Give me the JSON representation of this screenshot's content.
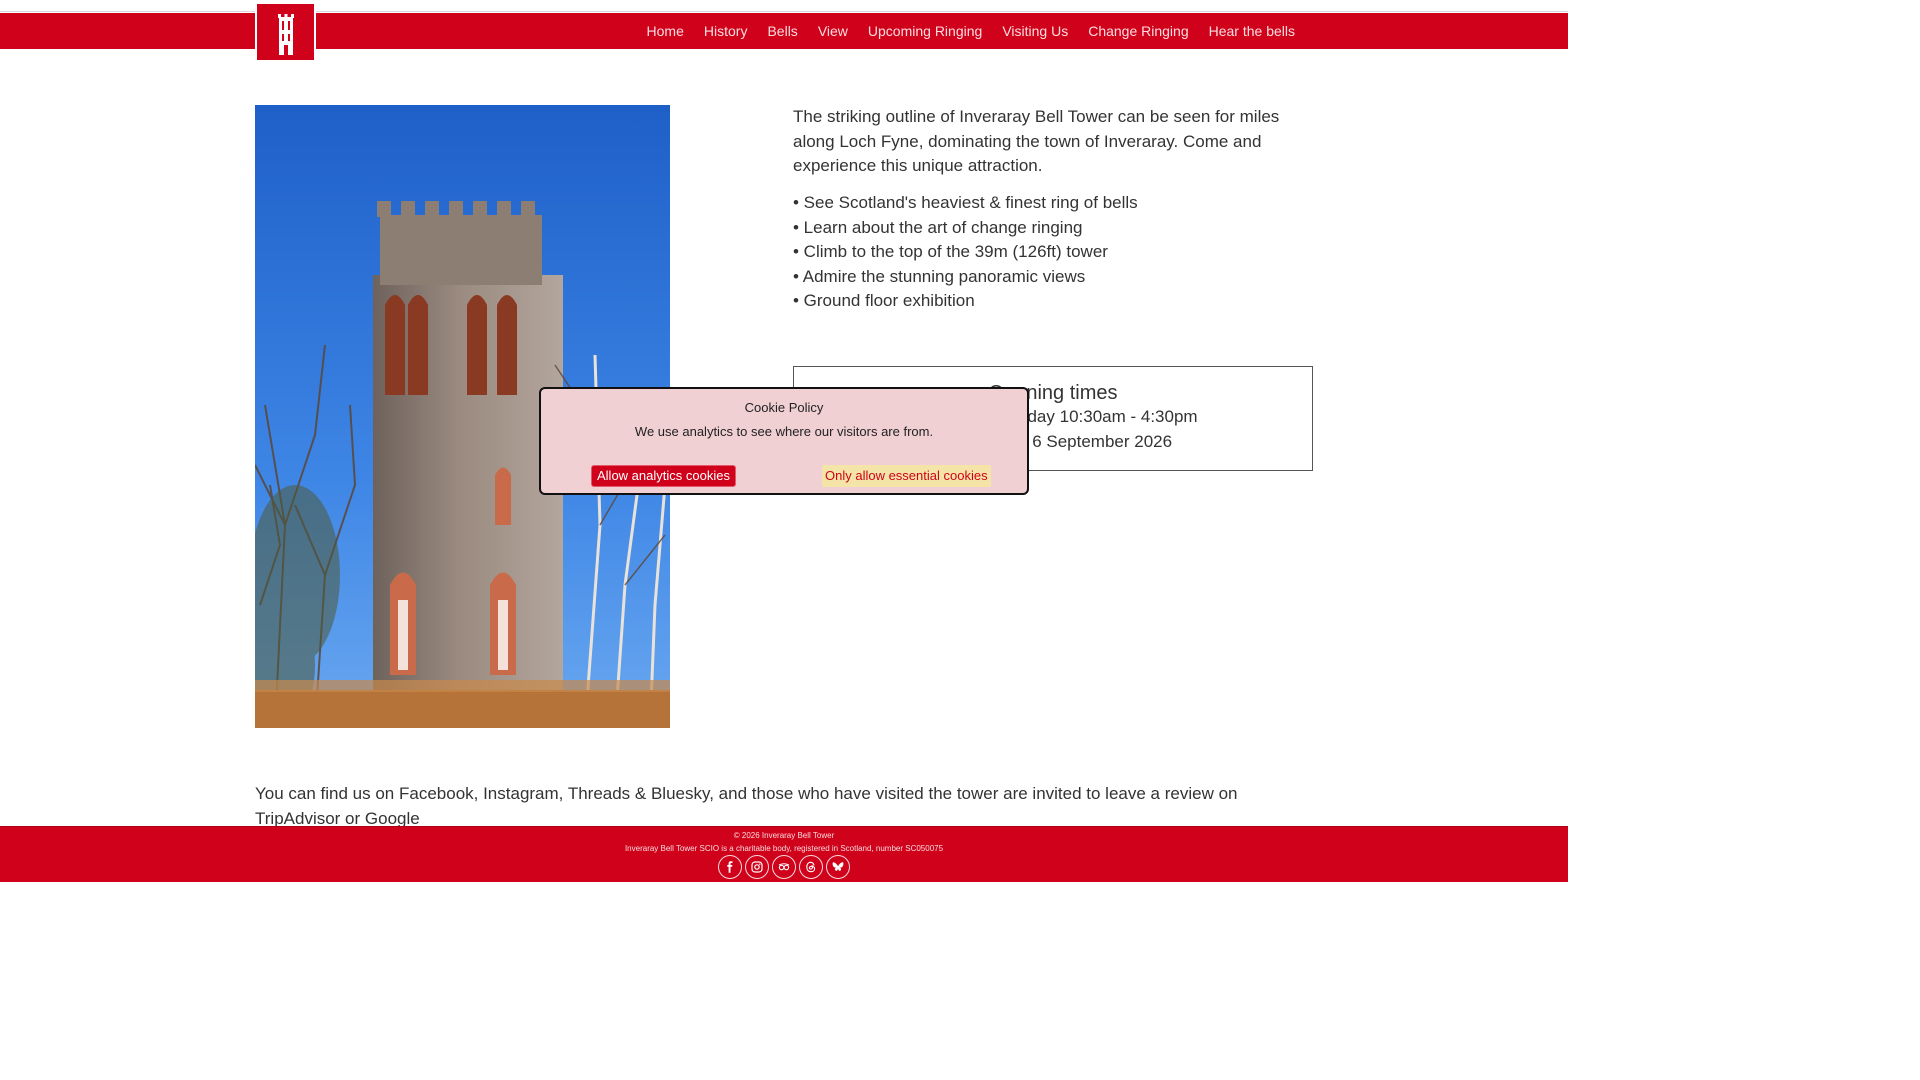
{
  "nav": {
    "logo_icon": "bell-tower-logo-icon",
    "items": [
      "Home",
      "History",
      "Bells",
      "View",
      "Upcoming Ringing",
      "Visiting Us",
      "Change Ringing",
      "Hear the bells"
    ]
  },
  "intro": {
    "paragraph": "The striking outline of Inveraray Bell Tower can be seen for miles along Loch Fyne, dominating the town of Inveraray. Come and experience this unique attraction."
  },
  "features": [
    "• See Scotland's heaviest & finest ring of bells",
    "• Learn about the art of change ringing",
    "• Climb to the top of the 39m (126ft) tower",
    "• Admire the stunning panoramic views",
    "• Ground floor exhibition"
  ],
  "opening": {
    "title": "Opening times",
    "line1": "Saturday & Sunday 10:30am - 4:30pm",
    "line2": "until Sunday 6 September 2026"
  },
  "bottom_text": "You can find us on Facebook, Instagram, Threads & Bluesky, and those who have visited the tower are invited to leave a review on TripAdvisor or Google",
  "footer": {
    "copyright": "© 2026 Inveraray Bell Tower",
    "registration": "Inveraray Bell Tower SCIO is a charitable body, registered in Scotland, number SC050075",
    "social_icons": [
      "facebook-icon",
      "instagram-icon",
      "tripadvisor-icon",
      "threads-icon",
      "bluesky-icon"
    ]
  },
  "cookie": {
    "title": "Cookie Policy",
    "message": "We use analytics to see where our visitors are from.",
    "allow_label": "Allow analytics cookies",
    "essential_label": "Only allow essential cookies"
  },
  "colors": {
    "brand_red": "#d0021b",
    "cookie_bg": "#f0d0d2",
    "essential_btn_bg": "#f4e4a8"
  }
}
